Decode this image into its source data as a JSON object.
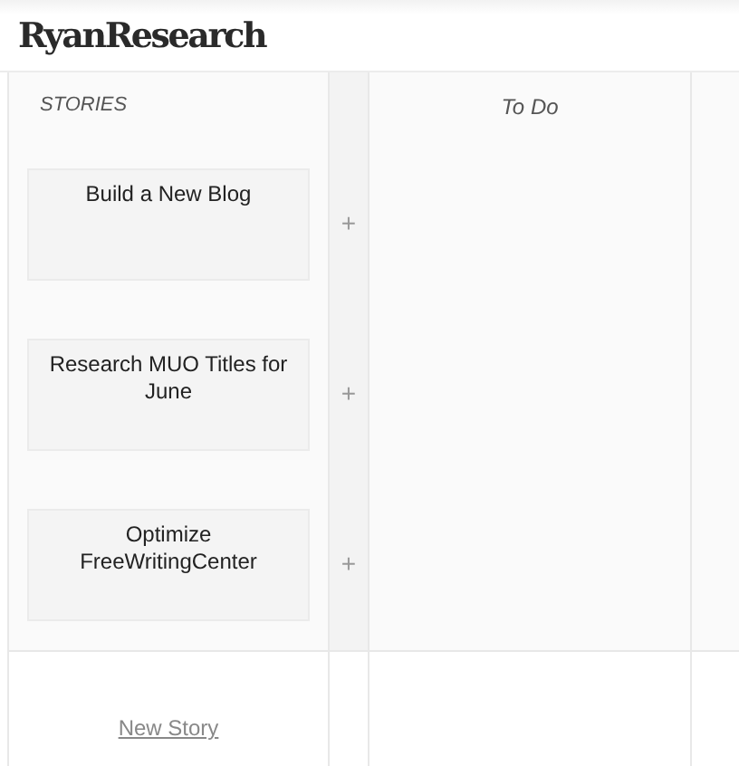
{
  "logo": "RyanResearch",
  "columns": [
    {
      "title": "STORIES"
    },
    {
      "title": "To Do"
    }
  ],
  "stories": [
    {
      "title": "Build a New Blog",
      "add": "+"
    },
    {
      "title": "Research MUO Titles for June",
      "add": "+"
    },
    {
      "title": "Optimize FreeWritingCenter",
      "add": "+"
    }
  ],
  "new_story": "New Story"
}
